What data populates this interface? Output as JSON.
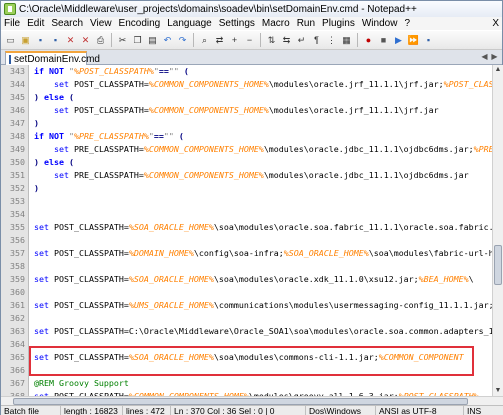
{
  "window": {
    "title": "C:\\Oracle\\Middleware\\user_projects\\domains\\soadev\\bin\\setDomainEnv.cmd - Notepad++"
  },
  "menu": [
    "File",
    "Edit",
    "Search",
    "View",
    "Encoding",
    "Language",
    "Settings",
    "Macro",
    "Run",
    "Plugins",
    "Window",
    "?"
  ],
  "menu_close": "X",
  "toolbar_icons": [
    "new-file-icon",
    "open-file-icon",
    "save-icon",
    "save-all-icon",
    "close-icon",
    "close-all-icon",
    "print-icon",
    "cut-icon",
    "copy-icon",
    "paste-icon",
    "undo-icon",
    "redo-icon",
    "find-icon",
    "replace-icon",
    "zoom-in-icon",
    "zoom-out-icon",
    "sync-vertical-icon",
    "sync-horizontal-icon",
    "word-wrap-icon",
    "show-all-chars-icon",
    "indent-guide-icon",
    "udl-icon",
    "record-macro-icon",
    "stop-macro-icon",
    "play-macro-icon",
    "run-macro-icon",
    "save-macro-icon"
  ],
  "tab": {
    "label": "setDomainEnv.cmd"
  },
  "editor": {
    "lines": [
      {
        "n": "343",
        "segs": [
          [
            "kw",
            "if NOT "
          ],
          [
            "str",
            "\""
          ],
          [
            "var",
            "%POST_CLASSPATH%"
          ],
          [
            "str",
            "\""
          ],
          [
            "op",
            "=="
          ],
          [
            "str",
            "\"\" "
          ],
          [
            "op",
            "("
          ]
        ]
      },
      {
        "n": "344",
        "segs": [
          [
            "plain",
            "    "
          ],
          [
            "cmd",
            "set"
          ],
          [
            "plain",
            " POST_CLASSPATH="
          ],
          [
            "var",
            "%COMMON_COMPONENTS_HOME%"
          ],
          [
            "plain",
            "\\modules\\oracle.jrf_11.1.1\\jrf.jar;"
          ],
          [
            "var",
            "%POST_CLASS"
          ]
        ]
      },
      {
        "n": "345",
        "segs": [
          [
            "op",
            ") "
          ],
          [
            "kw",
            "else"
          ],
          [
            "op",
            " ("
          ]
        ]
      },
      {
        "n": "346",
        "segs": [
          [
            "plain",
            "    "
          ],
          [
            "cmd",
            "set"
          ],
          [
            "plain",
            " POST_CLASSPATH="
          ],
          [
            "var",
            "%COMMON_COMPONENTS_HOME%"
          ],
          [
            "plain",
            "\\modules\\oracle.jrf_11.1.1\\jrf.jar"
          ]
        ]
      },
      {
        "n": "347",
        "segs": [
          [
            "op",
            ")"
          ]
        ]
      },
      {
        "n": "348",
        "segs": [
          [
            "kw",
            "if NOT "
          ],
          [
            "str",
            "\""
          ],
          [
            "var",
            "%PRE_CLASSPATH%"
          ],
          [
            "str",
            "\""
          ],
          [
            "op",
            "=="
          ],
          [
            "str",
            "\"\" "
          ],
          [
            "op",
            "("
          ]
        ]
      },
      {
        "n": "349",
        "segs": [
          [
            "plain",
            "    "
          ],
          [
            "cmd",
            "set"
          ],
          [
            "plain",
            " PRE_CLASSPATH="
          ],
          [
            "var",
            "%COMMON_COMPONENTS_HOME%"
          ],
          [
            "plain",
            "\\modules\\oracle.jdbc_11.1.1\\ojdbc6dms.jar;"
          ],
          [
            "var",
            "%PRE_"
          ]
        ]
      },
      {
        "n": "350",
        "segs": [
          [
            "op",
            ") "
          ],
          [
            "kw",
            "else"
          ],
          [
            "op",
            " ("
          ]
        ]
      },
      {
        "n": "351",
        "segs": [
          [
            "plain",
            "    "
          ],
          [
            "cmd",
            "set"
          ],
          [
            "plain",
            " PRE_CLASSPATH="
          ],
          [
            "var",
            "%COMMON_COMPONENTS_HOME%"
          ],
          [
            "plain",
            "\\modules\\oracle.jdbc_11.1.1\\ojdbc6dms.jar"
          ]
        ]
      },
      {
        "n": "352",
        "segs": [
          [
            "op",
            ")"
          ]
        ]
      },
      {
        "n": "353",
        "segs": []
      },
      {
        "n": "354",
        "segs": []
      },
      {
        "n": "355",
        "segs": [
          [
            "cmd",
            "set"
          ],
          [
            "plain",
            " POST_CLASSPATH="
          ],
          [
            "var",
            "%SOA_ORACLE_HOME%"
          ],
          [
            "plain",
            "\\soa\\modules\\oracle.soa.fabric_11.1.1\\oracle.soa.fabric.j"
          ]
        ]
      },
      {
        "n": "356",
        "segs": []
      },
      {
        "n": "357",
        "segs": [
          [
            "cmd",
            "set"
          ],
          [
            "plain",
            " POST_CLASSPATH="
          ],
          [
            "var",
            "%DOMAIN_HOME%"
          ],
          [
            "plain",
            "\\config\\soa-infra;"
          ],
          [
            "var",
            "%SOA_ORACLE_HOME%"
          ],
          [
            "plain",
            "\\soa\\modules\\fabric-url-ha"
          ]
        ]
      },
      {
        "n": "358",
        "segs": []
      },
      {
        "n": "359",
        "segs": [
          [
            "cmd",
            "set"
          ],
          [
            "plain",
            " POST_CLASSPATH="
          ],
          [
            "var",
            "%SOA_ORACLE_HOME%"
          ],
          [
            "plain",
            "\\soa\\modules\\oracle.xdk_11.1.0\\xsu12.jar;"
          ],
          [
            "var",
            "%BEA_HOME%"
          ],
          [
            "plain",
            "\\"
          ]
        ]
      },
      {
        "n": "360",
        "segs": []
      },
      {
        "n": "361",
        "segs": [
          [
            "cmd",
            "set"
          ],
          [
            "plain",
            " POST_CLASSPATH="
          ],
          [
            "var",
            "%UMS_ORACLE_HOME%"
          ],
          [
            "plain",
            "\\communications\\modules\\usermessaging-config_11.1.1.jar;"
          ]
        ]
      },
      {
        "n": "362",
        "segs": []
      },
      {
        "n": "363",
        "segs": [
          [
            "cmd",
            "set"
          ],
          [
            "plain",
            " POST_CLASSPATH=C:\\Oracle\\Middleware\\Oracle_SOA1\\soa\\modules\\oracle.soa.common.adapters_11"
          ]
        ]
      },
      {
        "n": "364",
        "segs": []
      },
      {
        "n": "365",
        "segs": [
          [
            "cmd",
            "set"
          ],
          [
            "plain",
            " POST_CLASSPATH="
          ],
          [
            "var",
            "%SOA_ORACLE_HOME%"
          ],
          [
            "plain",
            "\\soa\\modules\\commons-cli-1.1.jar;"
          ],
          [
            "var",
            "%COMMON_COMPONENT"
          ]
        ]
      },
      {
        "n": "366",
        "segs": []
      },
      {
        "n": "367",
        "segs": [
          [
            "rem",
            "@REM Groovy Support"
          ]
        ]
      },
      {
        "n": "368",
        "segs": [
          [
            "cmd",
            "set"
          ],
          [
            "plain",
            " POST_CLASSPATH="
          ],
          [
            "var",
            "%COMMON_COMPONENTS_HOME%"
          ],
          [
            "plain",
            "\\modules\\groovy-all-1.6.3.jar;"
          ],
          [
            "var",
            "%POST_CLASSPATH%"
          ]
        ]
      },
      {
        "n": "369",
        "segs": []
      },
      {
        "n": "370",
        "segs": []
      }
    ]
  },
  "status": {
    "filetype": "Batch file",
    "length": "length : 16823",
    "lines": "lines : 472",
    "position": "Ln : 370   Col : 36   Sel : 0 | 0",
    "eol": "Dos\\Windows",
    "encoding": "ANSI as UTF-8",
    "mode": "INS"
  }
}
